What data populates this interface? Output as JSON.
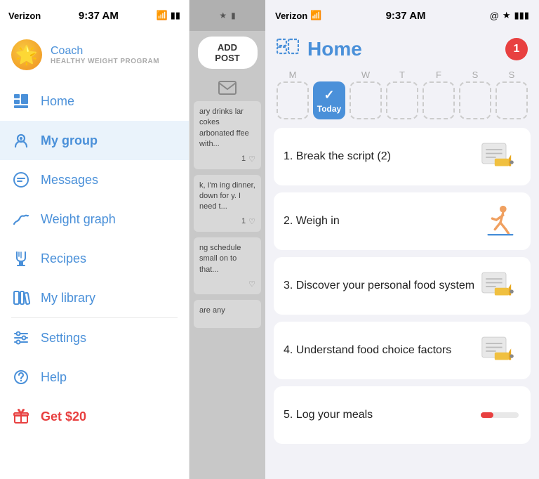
{
  "sidebar": {
    "status_time": "9:37 AM",
    "status_carrier": "Verizon",
    "coach": {
      "name": "Coach",
      "subtitle": "HEALTHY WEIGHT PROGRAM"
    },
    "nav_items": [
      {
        "id": "home",
        "label": "Home",
        "icon": "home",
        "active": false
      },
      {
        "id": "my-group",
        "label": "My group",
        "icon": "group",
        "active": true
      },
      {
        "id": "messages",
        "label": "Messages",
        "icon": "message",
        "active": false
      },
      {
        "id": "weight-graph",
        "label": "Weight graph",
        "icon": "weight",
        "active": false
      },
      {
        "id": "recipes",
        "label": "Recipes",
        "icon": "chef",
        "active": false
      },
      {
        "id": "my-library",
        "label": "My library",
        "icon": "library",
        "active": false
      },
      {
        "id": "settings",
        "label": "Settings",
        "icon": "settings",
        "active": false
      },
      {
        "id": "help",
        "label": "Help",
        "icon": "help",
        "active": false
      },
      {
        "id": "get20",
        "label": "Get $20",
        "icon": "gift",
        "active": false,
        "red": true
      }
    ]
  },
  "feed": {
    "add_post_label": "ADD POST",
    "items": [
      {
        "text": "ary drinks lar cokes arbonated ffee with...",
        "likes": "1",
        "has_heart": true
      },
      {
        "text": "k, I'm ing dinner, down for y. I need t...",
        "likes": "1",
        "has_heart": true
      },
      {
        "text": "ng schedule small on to that...",
        "likes": "",
        "has_heart": true
      },
      {
        "text": "are any",
        "likes": "",
        "has_heart": false
      }
    ]
  },
  "home": {
    "status_time": "9:37 AM",
    "status_carrier": "Verizon",
    "title": "Home",
    "notification_count": "1",
    "days": [
      {
        "label": "M",
        "today": false
      },
      {
        "label": "Today",
        "today": true
      },
      {
        "label": "W",
        "today": false
      },
      {
        "label": "T",
        "today": false
      },
      {
        "label": "F",
        "today": false
      },
      {
        "label": "S",
        "today": false
      },
      {
        "label": "S",
        "today": false
      }
    ],
    "tasks": [
      {
        "number": "1.",
        "title": "Break the script (2)",
        "type": "pencil"
      },
      {
        "number": "2.",
        "title": "Weigh in",
        "type": "walk"
      },
      {
        "number": "3.",
        "title": "Discover your personal food system",
        "type": "pencil"
      },
      {
        "number": "4.",
        "title": "Understand food choice factors",
        "type": "pencil"
      },
      {
        "number": "5.",
        "title": "Log your meals",
        "type": "bar"
      }
    ]
  }
}
